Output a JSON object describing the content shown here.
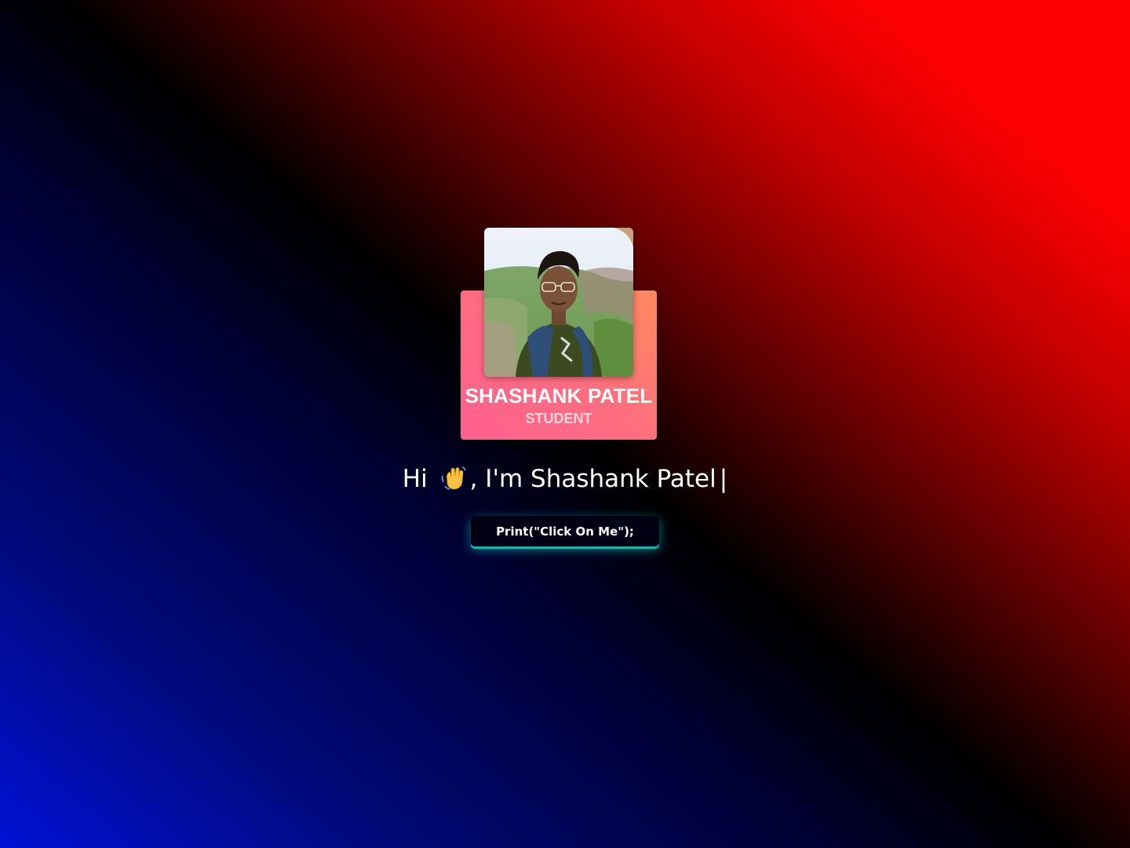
{
  "profile": {
    "name": "SHASHANK PATEL",
    "role": "STUDENT",
    "photo_icon": "profile-photo"
  },
  "greeting": {
    "prefix": "Hi",
    "wave_icon": "waving-hand-icon",
    "suffix": ", I'm Shashank Patel",
    "cursor": "|"
  },
  "button": {
    "label": "Print(\"Click On Me\");"
  },
  "colors": {
    "card_gradient_start": "#ff5f8f",
    "card_gradient_end": "#ff8a5c",
    "button_glow": "#1bb5b5",
    "background_red": "#ff0000",
    "background_blue": "#0012d6"
  }
}
